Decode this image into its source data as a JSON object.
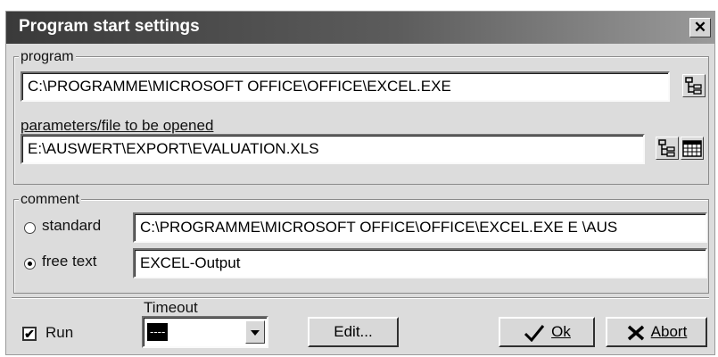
{
  "window": {
    "title": "Program start settings",
    "close_glyph": "✕"
  },
  "program": {
    "legend": "program",
    "value": "C:\\PROGRAMME\\MICROSOFT OFFICE\\OFFICE\\EXCEL.EXE",
    "params_label": "parameters/file to be opened",
    "params_value": "E:\\AUSWERT\\EXPORT\\EVALUATION.XLS"
  },
  "comment": {
    "legend": "comment",
    "standard_label": "standard",
    "standard_value": "C:\\PROGRAMME\\MICROSOFT OFFICE\\OFFICE\\EXCEL.EXE E \\AUS",
    "free_label": "free text",
    "free_value": "EXCEL-Output",
    "selected": "free text"
  },
  "footer": {
    "run_label": "Run",
    "run_checked": true,
    "timeout_label": "Timeout",
    "timeout_value": "----",
    "edit_label": "Edit...",
    "ok_label": "Ok",
    "abort_label": "Abort"
  },
  "icons": [
    "browse-tree-icon",
    "browse-tree-icon",
    "calendar-icon",
    "checkmark-icon",
    "cross-icon",
    "dropdown-arrow-icon"
  ]
}
